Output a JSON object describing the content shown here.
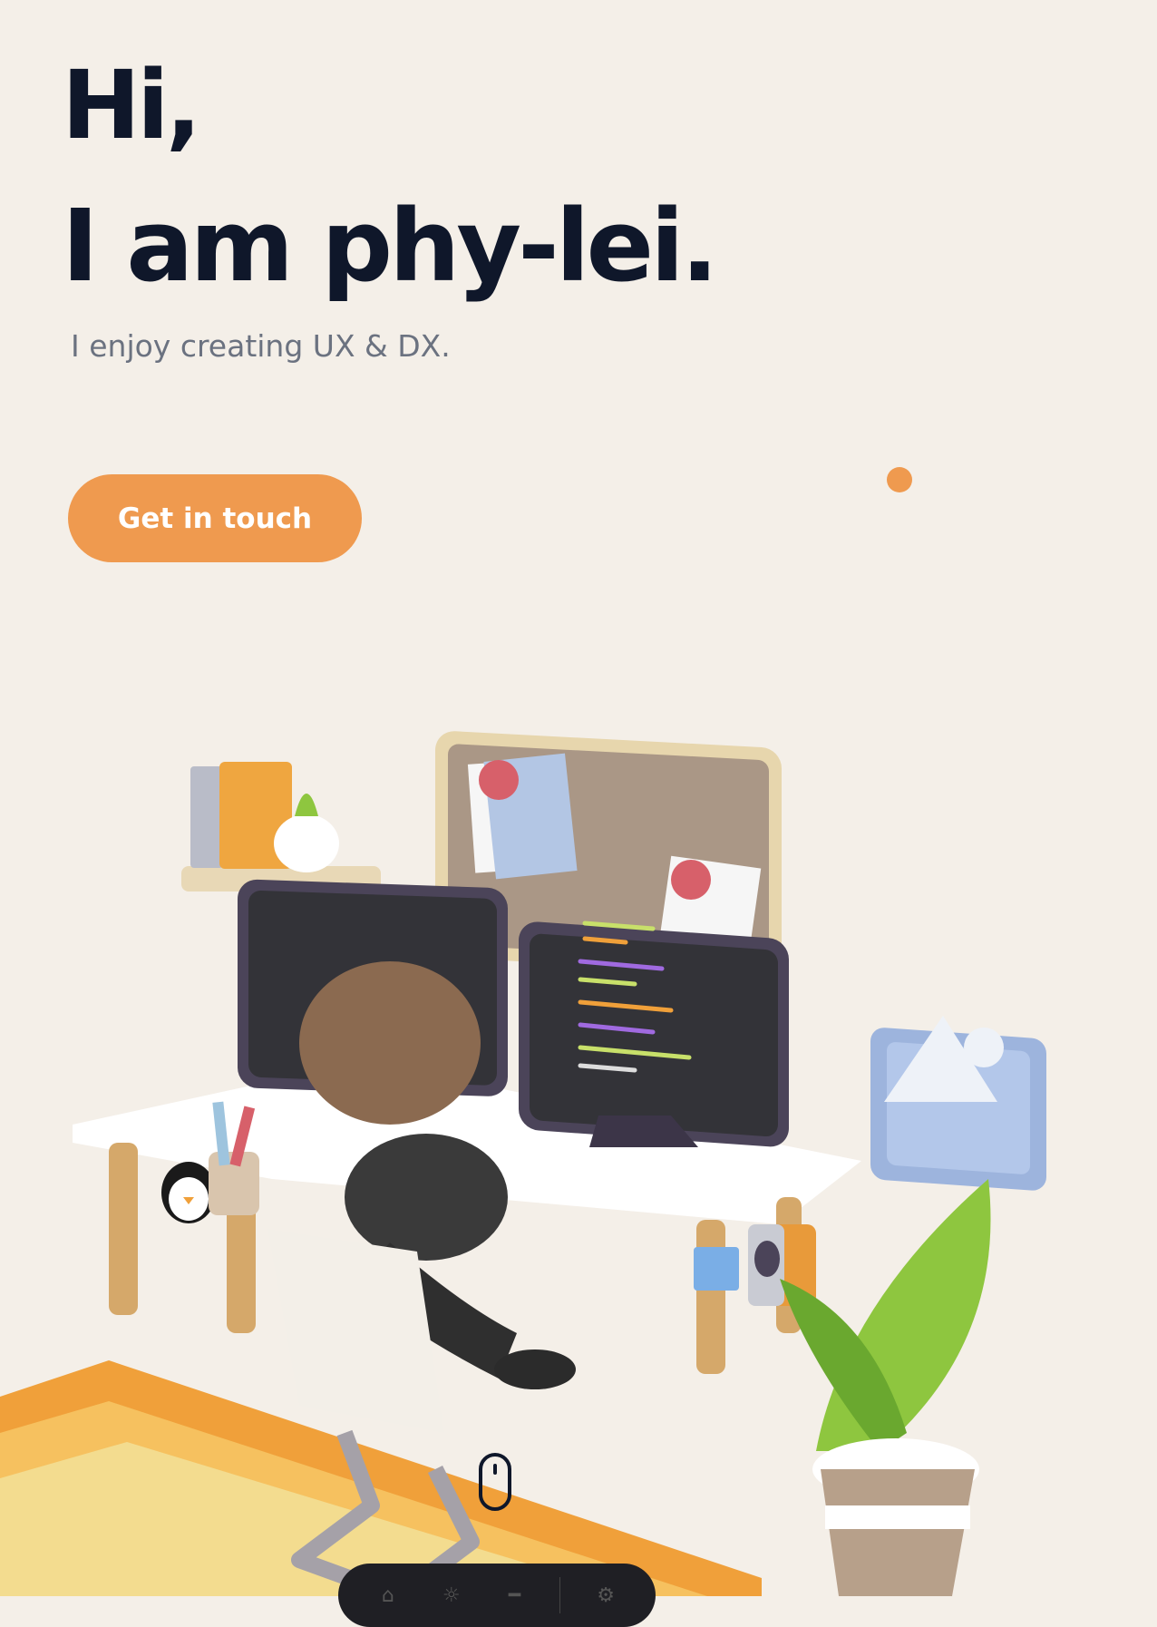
{
  "hero": {
    "greeting": "Hi,",
    "name_line": "I am phy-lei.",
    "tagline": "I enjoy creating UX & DX."
  },
  "cta": {
    "label": "Get in touch"
  },
  "colors": {
    "background": "#f4efe8",
    "heading": "#0f172a",
    "subtitle": "#6b7280",
    "accent": "#ef9a4f",
    "dock": "#1f1f24"
  },
  "illustration": {
    "description_icons": [
      "bookshelf-icon",
      "corkboard-icon",
      "monitor-icon",
      "picture-frame-icon",
      "plant-icon",
      "penguin-icon",
      "speaker-icon",
      "desk-icon",
      "chair-icon"
    ]
  },
  "dock": {
    "icons": [
      "home-icon",
      "lightbulb-icon",
      "toggle-icon",
      "settings-icon"
    ]
  },
  "scroll_indicator": {
    "icon": "mouse-icon"
  }
}
